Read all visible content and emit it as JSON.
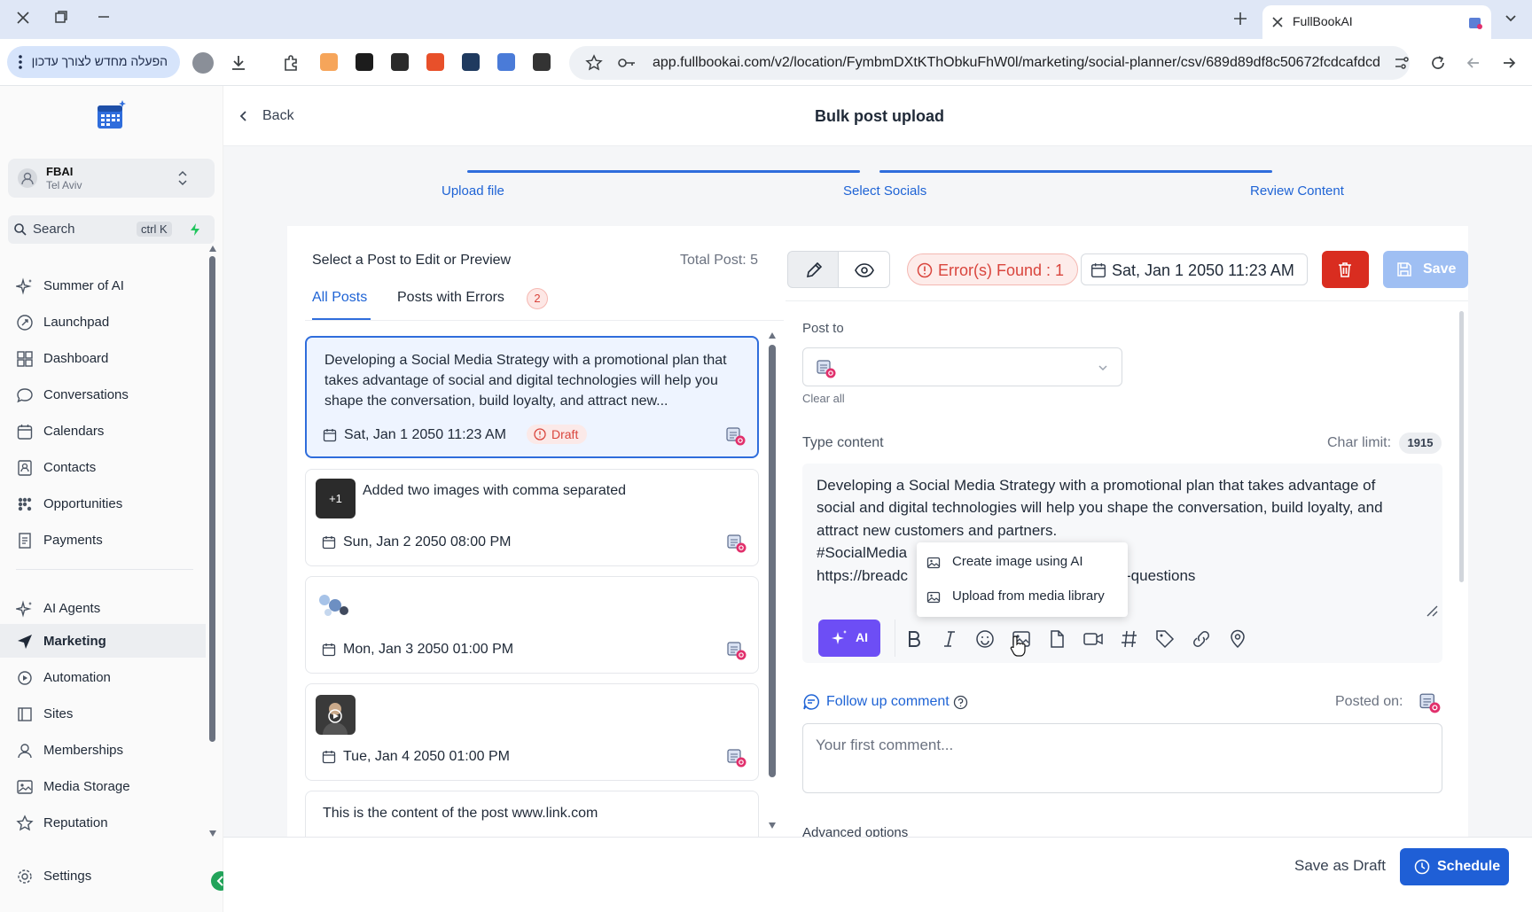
{
  "browser": {
    "tab_title": "FullBookAI",
    "url": "app.fullbookai.com/v2/location/FymbmDXtKThObkuFhW0l/marketing/social-planner/csv/689d89df8c50672fcdcafdcd",
    "relaunch_label": "הפעלה מחדש לצורך עדכון"
  },
  "sidebar": {
    "account_name": "FBAI",
    "account_location": "Tel Aviv",
    "search_placeholder": "Search",
    "search_shortcut": "ctrl K",
    "items": [
      {
        "label": "Summer of AI",
        "icon": "sparkle-icon"
      },
      {
        "label": "Launchpad",
        "icon": "rocket-icon"
      },
      {
        "label": "Dashboard",
        "icon": "grid-icon"
      },
      {
        "label": "Conversations",
        "icon": "chat-icon"
      },
      {
        "label": "Calendars",
        "icon": "calendar-icon"
      },
      {
        "label": "Contacts",
        "icon": "contacts-icon"
      },
      {
        "label": "Opportunities",
        "icon": "opportunities-icon"
      },
      {
        "label": "Payments",
        "icon": "payments-icon"
      },
      {
        "label": "AI Agents",
        "icon": "sparkle-icon"
      },
      {
        "label": "Marketing",
        "icon": "send-icon"
      },
      {
        "label": "Automation",
        "icon": "automation-icon"
      },
      {
        "label": "Sites",
        "icon": "sites-icon"
      },
      {
        "label": "Memberships",
        "icon": "memberships-icon"
      },
      {
        "label": "Media Storage",
        "icon": "image-icon"
      },
      {
        "label": "Reputation",
        "icon": "star-icon"
      }
    ],
    "settings_label": "Settings"
  },
  "header": {
    "back_label": "Back",
    "title": "Bulk post upload"
  },
  "steps": [
    "Upload file",
    "Select Socials",
    "Review Content"
  ],
  "list": {
    "heading": "Select a Post to Edit or Preview",
    "total": "Total Post: 5",
    "tab_all": "All Posts",
    "tab_errors": "Posts with Errors",
    "errors_count": "2",
    "posts": [
      {
        "text": "Developing a Social Media Strategy with a promotional plan that takes advantage of social and digital technologies will help you shape the conversation, build loyalty, and attract new...",
        "date": "Sat, Jan 1 2050 11:23 AM",
        "badge": "Draft"
      },
      {
        "text": "Added two images with comma separated",
        "date": "Sun, Jan 2 2050 08:00 PM",
        "thumb_badge": "+1"
      },
      {
        "text": "",
        "date": "Mon, Jan 3 2050 01:00 PM"
      },
      {
        "text": "",
        "date": "Tue, Jan 4 2050 01:00 PM"
      },
      {
        "text": "This is the content of the post www.link.com",
        "date": ""
      }
    ]
  },
  "editor": {
    "errors_label": "Error(s) Found : 1",
    "date_label": "Sat, Jan 1 2050 11:23 AM",
    "save_label": "Save",
    "post_to_label": "Post to",
    "clear_all": "Clear all",
    "type_content_label": "Type content",
    "char_limit_label": "Char limit:",
    "char_limit_value": "1915",
    "content_line1": "Developing a Social Media Strategy with a promotional plan that takes advantage of",
    "content_line2": "social and digital technologies will help you shape the conversation, build loyalty, and",
    "content_line3": "attract new customers and partners.",
    "content_line4": "#SocialMedia",
    "content_line5a": "https://breadc",
    "content_line5b": "-questions",
    "ai_label": "AI",
    "menu_create_ai": "Create image using AI",
    "menu_upload_library": "Upload from media library",
    "follow_up_label": "Follow up comment",
    "posted_on_label": "Posted on:",
    "comment_placeholder": "Your first comment...",
    "advanced_options": "Advanced options"
  },
  "footer": {
    "save_draft_label": "Save as Draft",
    "schedule_label": "Schedule"
  },
  "colors": {
    "primary": "#2f6ddc",
    "danger": "#d92d20",
    "ai_purple": "#6d4ef5",
    "error_red": "#d9453d"
  }
}
